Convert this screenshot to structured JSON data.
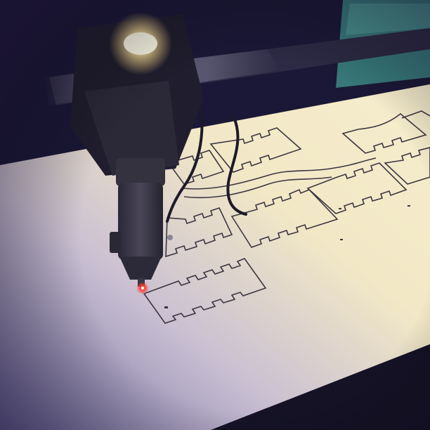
{
  "scene": {
    "subject": "laser-cutter-cutting-plywood-box-panels",
    "icons": {
      "laser_head": "laser-head-icon",
      "laser_beam": "laser-beam-icon",
      "spotlight": "spotlight-icon"
    },
    "colors": {
      "background_dark": "#0e0c1e",
      "wood_light": "#f1e6c2",
      "wood_shadow": "#8a7fa8",
      "cut_line": "#3c3642",
      "laser_red": "#ff3b2f",
      "glare": "#fff6c8",
      "screen_teal": "#3d8a86"
    }
  }
}
